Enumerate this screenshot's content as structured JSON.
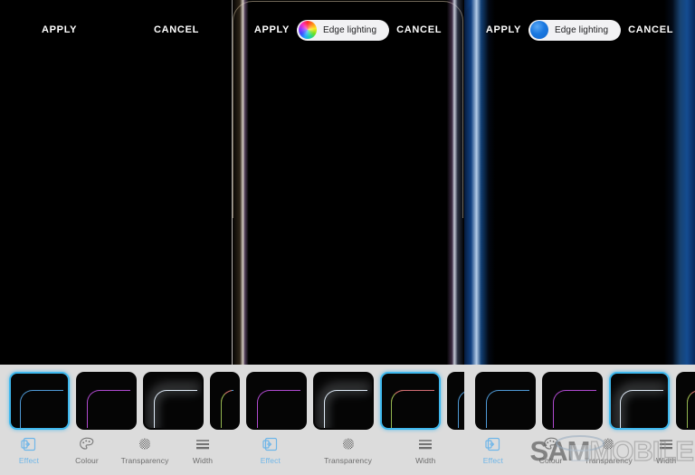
{
  "app": {
    "title": "Edge lighting",
    "watermark": {
      "bold": "SAM",
      "outline": "MOBILE"
    }
  },
  "panels": [
    {
      "id": "panel-left",
      "name": "edge-lighting-preview-plain",
      "header": {
        "apply_label": "APPLY",
        "cancel_label": "CANCEL",
        "show_pill": false,
        "pill_label": "",
        "pill_dot": ""
      },
      "edge_style": "none",
      "thumbnails": [
        {
          "name": "effect-thumb-basic",
          "style": "blue",
          "selected": true
        },
        {
          "name": "effect-thumb-violet",
          "style": "violet",
          "selected": false
        },
        {
          "name": "effect-thumb-glow",
          "style": "glow",
          "selected": false
        },
        {
          "name": "effect-thumb-rainbow",
          "style": "rain",
          "selected": false
        }
      ],
      "tabs": [
        {
          "label": "Effect",
          "icon": "effect-icon",
          "active": true
        },
        {
          "label": "Colour",
          "icon": "palette-icon",
          "active": false
        },
        {
          "label": "Transparency",
          "icon": "transparency-icon",
          "active": false
        },
        {
          "label": "Width",
          "icon": "width-icon",
          "active": false
        }
      ],
      "watermark": false
    },
    {
      "id": "panel-middle",
      "name": "edge-lighting-preview-rainbow",
      "header": {
        "apply_label": "APPLY",
        "cancel_label": "CANCEL",
        "show_pill": true,
        "pill_label": "Edge lighting",
        "pill_dot": "rainbow-colour-wheel-icon"
      },
      "edge_style": "rainbow",
      "thumbnails": [
        {
          "name": "effect-thumb-basic",
          "style": "blue",
          "selected": false
        },
        {
          "name": "effect-thumb-violet",
          "style": "violet",
          "selected": false
        },
        {
          "name": "effect-thumb-glow",
          "style": "glow",
          "selected": false
        },
        {
          "name": "effect-thumb-rainbow",
          "style": "rain",
          "selected": true
        }
      ],
      "tabs": [
        {
          "label": "Effect",
          "icon": "effect-icon",
          "active": true
        },
        {
          "label": "Transparency",
          "icon": "transparency-icon",
          "active": false
        },
        {
          "label": "Width",
          "icon": "width-icon",
          "active": false
        }
      ],
      "watermark": false
    },
    {
      "id": "panel-right",
      "name": "edge-lighting-preview-blue",
      "header": {
        "apply_label": "APPLY",
        "cancel_label": "CANCEL",
        "show_pill": true,
        "pill_label": "Edge lighting",
        "pill_dot": "blue-colour-swatch-icon"
      },
      "edge_style": "blue",
      "thumbnails": [
        {
          "name": "effect-thumb-basic",
          "style": "blue",
          "selected": false
        },
        {
          "name": "effect-thumb-violet",
          "style": "violet",
          "selected": false
        },
        {
          "name": "effect-thumb-glow",
          "style": "glow",
          "selected": true
        },
        {
          "name": "effect-thumb-rainbow",
          "style": "rain",
          "selected": false
        }
      ],
      "tabs": [
        {
          "label": "Effect",
          "icon": "effect-icon",
          "active": true
        },
        {
          "label": "Colour",
          "icon": "palette-icon",
          "active": false
        },
        {
          "label": "Transparency",
          "icon": "transparency-icon",
          "active": false
        },
        {
          "label": "Width",
          "icon": "width-icon",
          "active": false
        }
      ],
      "watermark": true
    }
  ],
  "colors": {
    "accent_blue": "#3fb8ee",
    "tab_active": "#6fb6e8",
    "tab_inactive": "#6d6d6d",
    "bottom_bg": "#dcdcdc",
    "screen_bg": "#000000",
    "pill_bg": "#f2f2f4",
    "pill_text": "#1c1c1e",
    "blue_glow": "#1a78e0"
  }
}
